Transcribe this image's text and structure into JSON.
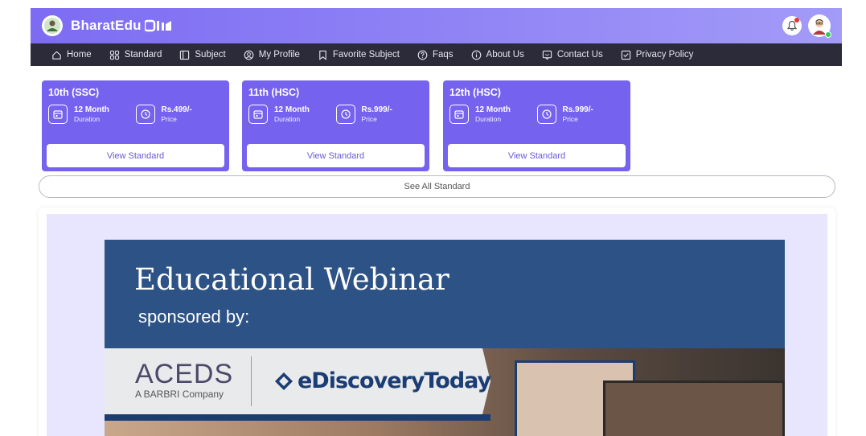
{
  "header": {
    "brand": "BharatEdu",
    "colors": {
      "header_start": "#7d6cf3",
      "header_end": "#a39bf8",
      "nav_bg": "#2b2b3a",
      "card_bg": "#7563ef"
    }
  },
  "nav": {
    "items": [
      {
        "label": "Home",
        "icon": "home-icon"
      },
      {
        "label": "Standard",
        "icon": "grid-icon"
      },
      {
        "label": "Subject",
        "icon": "book-icon"
      },
      {
        "label": "My Profile",
        "icon": "user-circle-icon"
      },
      {
        "label": "Favorite Subject",
        "icon": "bookmark-icon"
      },
      {
        "label": "Faqs",
        "icon": "question-icon"
      },
      {
        "label": "About Us",
        "icon": "info-icon"
      },
      {
        "label": "Contact Us",
        "icon": "chat-icon"
      },
      {
        "label": "Privacy Policy",
        "icon": "checklist-icon"
      }
    ]
  },
  "standards": [
    {
      "title": "10th (SSC)",
      "duration": "12 Month",
      "duration_label": "Duration",
      "price": "Rs.499/-",
      "price_label": "Price",
      "button": "View Standard"
    },
    {
      "title": "11th (HSC)",
      "duration": "12 Month",
      "duration_label": "Duration",
      "price": "Rs.999/-",
      "price_label": "Price",
      "button": "View Standard"
    },
    {
      "title": "12th (HSC)",
      "duration": "12 Month",
      "duration_label": "Duration",
      "price": "Rs.999/-",
      "price_label": "Price",
      "button": "View Standard"
    }
  ],
  "see_all": "See All Standard",
  "banner": {
    "title": "Educational Webinar",
    "subtitle": "sponsored by:",
    "sponsor1": "ACEDS",
    "sponsor1_sub": "A BARBRI Company",
    "sponsor2": "eDiscoveryToday"
  }
}
